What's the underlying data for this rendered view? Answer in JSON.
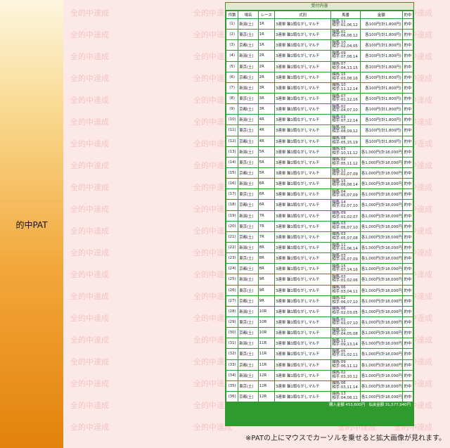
{
  "sidebar": {
    "label": "的中PAT"
  },
  "watermark": {
    "text": "全的中達成"
  },
  "ticket": {
    "title": "受付内容",
    "headers": [
      "件数",
      "場名",
      "レース",
      "式別",
      "馬番",
      "金額",
      "的中"
    ],
    "rows": [
      {
        "no": "(1)",
        "place": "新潟(土)",
        "race": "1R",
        "bet": "3連単 軸1頭ながしマルチ",
        "horse1": "軸馬:11",
        "horse2": "相手:01,06,12",
        "amount": "各100円(計1,800円)",
        "hit": "的中"
      },
      {
        "no": "(2)",
        "place": "東京(土)",
        "race": "1R",
        "bet": "3連単 軸1頭ながしマルチ",
        "horse1": "軸馬:01",
        "horse2": "相手:06,08,12",
        "amount": "各100円(計1,800円)",
        "hit": "的中"
      },
      {
        "no": "(3)",
        "place": "京都(土)",
        "race": "1R",
        "bet": "3連単 軸1頭ながしマルチ",
        "horse1": "軸馬:10",
        "horse2": "相手:02,04,05",
        "amount": "各100円(計1,800円)",
        "hit": "的中"
      },
      {
        "no": "(4)",
        "place": "新潟(土)",
        "race": "2R",
        "bet": "3連単 軸1頭ながしマルチ",
        "horse1": "軸馬:09",
        "horse2": "相手:07,08,14",
        "amount": "各100円(計1,800円)",
        "hit": "的中"
      },
      {
        "no": "(5)",
        "place": "東京(土)",
        "race": "2R",
        "bet": "3連単 軸1頭ながしマルチ",
        "horse1": "軸馬:07",
        "horse2": "相手:04,13,15",
        "amount": "各100円(計1,800円)",
        "hit": "的中"
      },
      {
        "no": "(6)",
        "place": "京都(土)",
        "race": "2R",
        "bet": "3連単 軸1頭ながしマルチ",
        "horse1": "軸馬:15",
        "horse2": "相手:03,08,16",
        "amount": "各100円(計1,800円)",
        "hit": "的中"
      },
      {
        "no": "(7)",
        "place": "新潟(土)",
        "race": "3R",
        "bet": "3連単 軸1頭ながしマルチ",
        "horse1": "軸馬:10",
        "horse2": "相手:11,12,14",
        "amount": "各100円(計1,800円)",
        "hit": "的中"
      },
      {
        "no": "(8)",
        "place": "東京(土)",
        "race": "3R",
        "bet": "3連単 軸1頭ながしマルチ",
        "horse1": "軸馬:07",
        "horse2": "相手:01,12,16",
        "amount": "各100円(計1,800円)",
        "hit": "的中"
      },
      {
        "no": "(9)",
        "place": "京都(土)",
        "race": "3R",
        "bet": "3連単 軸1頭ながしマルチ",
        "horse1": "軸馬:02",
        "horse2": "相手:04,07,10",
        "amount": "各100円(計1,800円)",
        "hit": "的中"
      },
      {
        "no": "(10)",
        "place": "新潟(土)",
        "race": "4R",
        "bet": "3連単 軸1頭ながしマルチ",
        "horse1": "軸馬:03",
        "horse2": "相手:07,12,14",
        "amount": "各100円(計1,800円)",
        "hit": "的中"
      },
      {
        "no": "(11)",
        "place": "東京(土)",
        "race": "4R",
        "bet": "3連単 軸1頭ながしマルチ",
        "horse1": "軸馬:06",
        "horse2": "相手:08,09,12",
        "amount": "各100円(計1,800円)",
        "hit": "的中"
      },
      {
        "no": "(12)",
        "place": "京都(土)",
        "race": "4R",
        "bet": "3連単 軸1頭ながしマルチ",
        "horse1": "軸馬:08",
        "horse2": "相手:05,15,19",
        "amount": "各100円(計1,800円)",
        "hit": "的中"
      },
      {
        "no": "(13)",
        "place": "新潟(土)",
        "race": "5R",
        "bet": "3連単 軸1頭ながしマルチ",
        "horse1": "軸馬:03",
        "horse2": "相手:10,11,12",
        "amount": "各1,000円(計18,000円)",
        "hit": "的中"
      },
      {
        "no": "(14)",
        "place": "東京(土)",
        "race": "5R",
        "bet": "3連単 軸1頭ながしマルチ",
        "horse1": "軸馬:02",
        "horse2": "相手:05,11,12",
        "amount": "各1,000円(計18,000円)",
        "hit": "的中"
      },
      {
        "no": "(15)",
        "place": "京都(土)",
        "race": "5R",
        "bet": "3連単 軸1頭ながしマルチ",
        "horse1": "軸馬:12",
        "horse2": "相手:02,07,09",
        "amount": "各1,000円(計18,000円)",
        "hit": "的中"
      },
      {
        "no": "(16)",
        "place": "新潟(土)",
        "race": "6R",
        "bet": "3連単 軸1頭ながしマルチ",
        "horse1": "軸馬:15",
        "horse2": "相手:06,08,14",
        "amount": "各1,000円(計18,000円)",
        "hit": "的中"
      },
      {
        "no": "(17)",
        "place": "東京(土)",
        "race": "6R",
        "bet": "3連単 軸1頭ながしマルチ",
        "horse1": "軸馬:04",
        "horse2": "相手:05,07,09",
        "amount": "各1,000円(計18,000円)",
        "hit": "的中"
      },
      {
        "no": "(18)",
        "place": "京都(土)",
        "race": "6R",
        "bet": "3連単 軸1頭ながしマルチ",
        "horse1": "軸馬:14",
        "horse2": "相手:02,07,10",
        "amount": "各1,000円(計18,000円)",
        "hit": "的中"
      },
      {
        "no": "(19)",
        "place": "新潟(土)",
        "race": "7R",
        "bet": "3連単 軸1頭ながしマルチ",
        "horse1": "軸馬:09",
        "horse2": "相手:01,02,07",
        "amount": "各1,000円(計18,000円)",
        "hit": "的中"
      },
      {
        "no": "(20)",
        "place": "東京(土)",
        "race": "7R",
        "bet": "3連単 軸1頭ながしマルチ",
        "horse1": "軸馬:03",
        "horse2": "相手:06,07,10",
        "amount": "各1,000円(計18,000円)",
        "hit": "的中"
      },
      {
        "no": "(21)",
        "place": "京都(土)",
        "race": "7R",
        "bet": "3連単 軸1頭ながしマルチ",
        "horse1": "軸馬:03",
        "horse2": "相手:05,07,08",
        "amount": "各1,000円(計18,000円)",
        "hit": "的中"
      },
      {
        "no": "(22)",
        "place": "新潟(土)",
        "race": "8R",
        "bet": "3連単 軸1頭ながしマルチ",
        "horse1": "軸馬:11",
        "horse2": "相手:01,06,14",
        "amount": "各1,000円(計18,000円)",
        "hit": "的中"
      },
      {
        "no": "(23)",
        "place": "東京(土)",
        "race": "8R",
        "bet": "3連単 軸1頭ながしマルチ",
        "horse1": "軸馬:03",
        "horse2": "相手:05,07,09",
        "amount": "各1,000円(計18,000円)",
        "hit": "的中"
      },
      {
        "no": "(24)",
        "place": "京都(土)",
        "race": "8R",
        "bet": "3連単 軸1頭ながしマルチ",
        "horse1": "軸馬:15",
        "horse2": "相手:07,14,16",
        "amount": "各1,000円(計18,000円)",
        "hit": "的中"
      },
      {
        "no": "(25)",
        "place": "新潟(土)",
        "race": "9R",
        "bet": "3連単 軸1頭ながしマルチ",
        "horse1": "軸馬:03",
        "horse2": "相手:01,02,06",
        "amount": "各1,000円(計18,000円)",
        "hit": "的中"
      },
      {
        "no": "(26)",
        "place": "東京(土)",
        "race": "9R",
        "bet": "3連単 軸1頭ながしマルチ",
        "horse1": "軸馬:06",
        "horse2": "相手:03,04,11",
        "amount": "各1,000円(計18,000円)",
        "hit": "的中"
      },
      {
        "no": "(27)",
        "place": "京都(土)",
        "race": "9R",
        "bet": "3連単 軸1頭ながしマルチ",
        "horse1": "軸馬:02",
        "horse2": "相手:06,07,10",
        "amount": "各1,000円(計18,000円)",
        "hit": "的中"
      },
      {
        "no": "(28)",
        "place": "新潟(土)",
        "race": "10R",
        "bet": "3連単 軸1頭ながしマルチ",
        "horse1": "軸馬:06",
        "horse2": "相手:02,03,05",
        "amount": "各1,000円(計18,000円)",
        "hit": "的中"
      },
      {
        "no": "(29)",
        "place": "東京(土)",
        "race": "10R",
        "bet": "3連単 軸1頭ながしマルチ",
        "horse1": "軸馬:01",
        "horse2": "相手:03,07,10",
        "amount": "各1,000円(計18,000円)",
        "hit": "的中"
      },
      {
        "no": "(30)",
        "place": "京都(土)",
        "race": "10R",
        "bet": "3連単 軸1頭ながしマルチ",
        "horse1": "軸馬:10",
        "horse2": "相手:04,05,08",
        "amount": "各1,000円(計18,000円)",
        "hit": "的中"
      },
      {
        "no": "(31)",
        "place": "新潟(土)",
        "race": "11R",
        "bet": "3連単 軸1頭ながしマルチ",
        "horse1": "軸馬:11",
        "horse2": "相手:09,13,14",
        "amount": "各1,000円(計18,000円)",
        "hit": "的中"
      },
      {
        "no": "(32)",
        "place": "東京(土)",
        "race": "11R",
        "bet": "3連単 軸1頭ながしマルチ",
        "horse1": "軸馬:05",
        "horse2": "相手:01,02,11",
        "amount": "各1,000円(計18,000円)",
        "hit": "的中"
      },
      {
        "no": "(33)",
        "place": "京都(土)",
        "race": "11R",
        "bet": "3連単 軸1頭ながしマルチ",
        "horse1": "軸馬:09",
        "horse2": "相手:06,11,12",
        "amount": "各1,000円(計18,000円)",
        "hit": "的中"
      },
      {
        "no": "(34)",
        "place": "新潟(土)",
        "race": "12R",
        "bet": "3連単 軸1頭ながしマルチ",
        "horse1": "軸馬:02",
        "horse2": "相手:03,10,12",
        "amount": "各1,000円(計18,000円)",
        "hit": "的中"
      },
      {
        "no": "(35)",
        "place": "東京(土)",
        "race": "12R",
        "bet": "3連単 軸1頭ながしマルチ",
        "horse1": "軸馬:06",
        "horse2": "相手:03,11,14",
        "amount": "各1,000円(計18,000円)",
        "hit": "的中"
      },
      {
        "no": "(36)",
        "place": "京都(土)",
        "race": "12R",
        "bet": "3連単 軸1頭ながしマルチ",
        "horse1": "軸馬:13",
        "horse2": "相手:04,08,11",
        "amount": "各1,000円(計18,000円)",
        "hit": "的中"
      }
    ],
    "footer": "購入金額 453,600円　払戻金額 31,577,940円"
  },
  "note": "※PATの上にマウスでカーソルを乗せると拡大画像が見れます。",
  "colors": {
    "sidebar_top": "#fdf6df",
    "sidebar_bottom": "#e3820b",
    "panel_bg": "#fde8e8",
    "ticket_green": "#2f9b2f",
    "watermark": "#f3c4c4"
  }
}
